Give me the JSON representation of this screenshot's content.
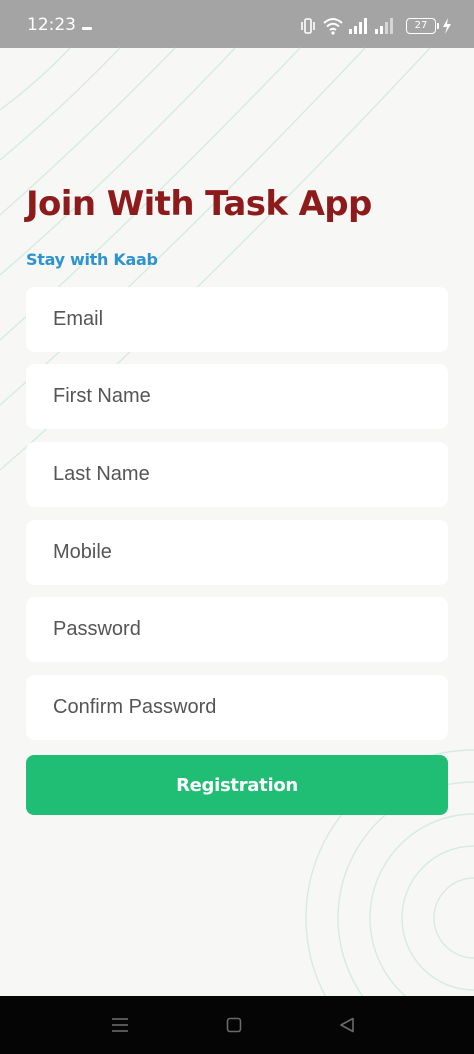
{
  "status_bar": {
    "time": "12:23",
    "battery_level": "27",
    "icons": [
      "vibrate-icon",
      "wifi-icon",
      "signal-icon",
      "signal-icon",
      "battery-icon",
      "charging-icon"
    ]
  },
  "header": {
    "title": "Join With Task App",
    "subtitle": "Stay with Kaab"
  },
  "form": {
    "fields": [
      {
        "name": "email",
        "placeholder": "Email",
        "value": ""
      },
      {
        "name": "first_name",
        "placeholder": "First Name",
        "value": ""
      },
      {
        "name": "last_name",
        "placeholder": "Last Name",
        "value": ""
      },
      {
        "name": "mobile",
        "placeholder": "Mobile",
        "value": ""
      },
      {
        "name": "password",
        "placeholder": "Password",
        "value": ""
      },
      {
        "name": "confirm_password",
        "placeholder": "Confirm Password",
        "value": ""
      }
    ],
    "submit_label": "Registration"
  },
  "nav_bar": {
    "buttons": [
      "menu-icon",
      "home-icon",
      "back-icon"
    ]
  },
  "colors": {
    "title": "#8e1b1b",
    "subtitle": "#2e94cf",
    "button": "#20be74",
    "background": "#f7f7f6",
    "decor_lines": "#d5ece0"
  }
}
